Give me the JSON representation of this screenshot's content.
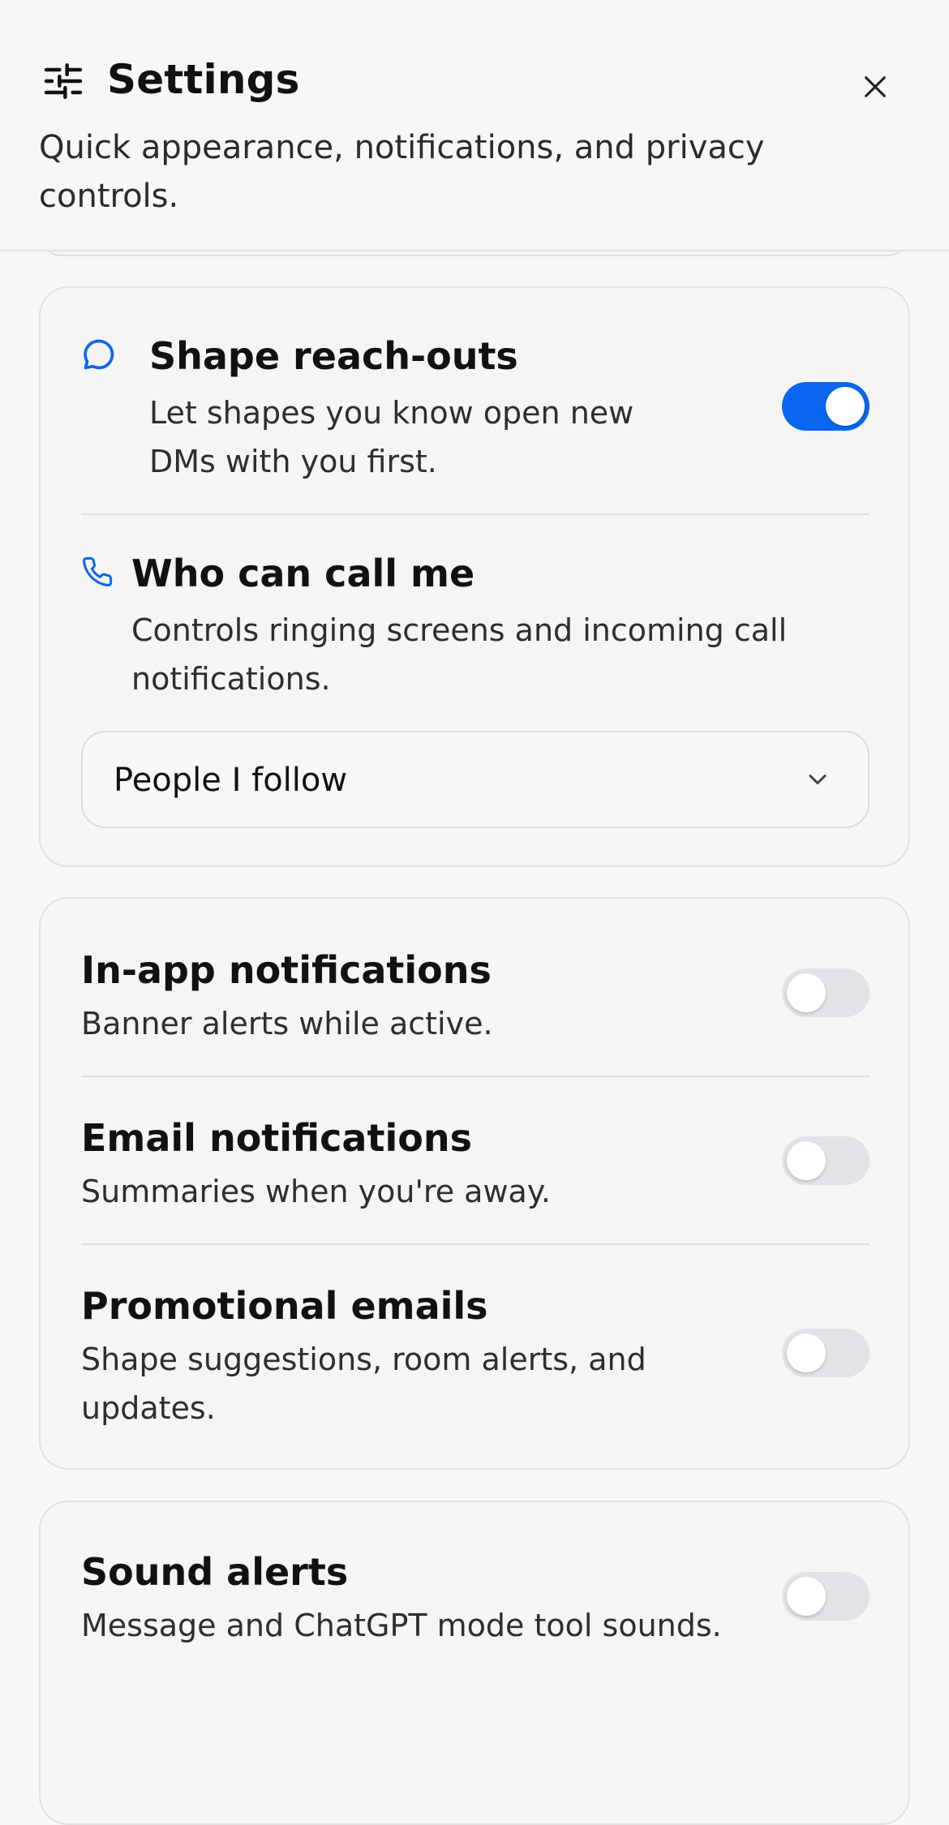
{
  "header": {
    "icon": "sliders-icon",
    "title": "Settings",
    "subtitle": "Quick appearance, notifications, and privacy controls.",
    "close_icon": "close-icon"
  },
  "privacy": {
    "reach_outs": {
      "icon": "chat-bubble-icon",
      "title": "Shape reach-outs",
      "description": "Let shapes you know open new DMs with you first.",
      "enabled": true
    },
    "calls": {
      "icon": "phone-icon",
      "title": "Who can call me",
      "description": "Controls ringing screens and incoming call notifications.",
      "selected_option": "People I follow"
    }
  },
  "notifications": {
    "in_app": {
      "title": "In-app notifications",
      "description": "Banner alerts while active.",
      "enabled": false
    },
    "email": {
      "title": "Email notifications",
      "description": "Summaries when you're away.",
      "enabled": false
    },
    "promotional": {
      "title": "Promotional emails",
      "description": "Shape suggestions, room alerts, and updates.",
      "enabled": false
    }
  },
  "sound": {
    "title": "Sound alerts",
    "description": "Message and ChatGPT mode tool sounds.",
    "enabled": false
  },
  "colors": {
    "accent": "#0a66f0",
    "toggle_off": "#e3e3e7",
    "background": "#f7f7f8"
  }
}
